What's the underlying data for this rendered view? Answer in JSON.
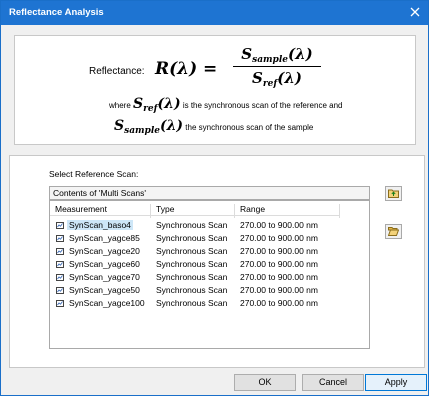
{
  "window": {
    "title": "Reflectance Analysis",
    "close_icon": "close-icon"
  },
  "formula": {
    "label": "Reflectance:",
    "lhs": "R(λ) =",
    "numerator_symbol": "S",
    "numerator_sub": "sample",
    "numerator_arg": "(λ)",
    "denominator_symbol": "S",
    "denominator_sub": "ref",
    "denominator_arg": "(λ)",
    "where_prefix": "where",
    "where_text": "is the synchronous scan of the reference and",
    "sample_text": "the synchronous scan of the sample"
  },
  "select": {
    "label": "Select Reference Scan:",
    "contents": "Contents of 'Multi Scans'",
    "columns": [
      "Measurement",
      "Type",
      "Range"
    ],
    "rows": [
      {
        "name": "SynScan_baso4",
        "type": "Synchronous Scan",
        "range": "270.00 to 900.00 nm",
        "selected": true
      },
      {
        "name": "SynScan_yagce85",
        "type": "Synchronous Scan",
        "range": "270.00 to 900.00 nm"
      },
      {
        "name": "SynScan_yagce20",
        "type": "Synchronous Scan",
        "range": "270.00 to 900.00 nm"
      },
      {
        "name": "SynScan_yagce60",
        "type": "Synchronous Scan",
        "range": "270.00 to 900.00 nm"
      },
      {
        "name": "SynScan_yagce70",
        "type": "Synchronous Scan",
        "range": "270.00 to 900.00 nm"
      },
      {
        "name": "SynScan_yagce50",
        "type": "Synchronous Scan",
        "range": "270.00 to 900.00 nm"
      },
      {
        "name": "SynScan_yagce100",
        "type": "Synchronous Scan",
        "range": "270.00 to 900.00 nm"
      }
    ],
    "side_buttons": [
      "up-folder-icon",
      "open-folder-icon"
    ]
  },
  "buttons": {
    "ok": "OK",
    "cancel": "Cancel",
    "apply": "Apply"
  },
  "colors": {
    "titlebar": "#1e74d2",
    "selection": "#cde6f7",
    "primary_border": "#0078d7"
  }
}
